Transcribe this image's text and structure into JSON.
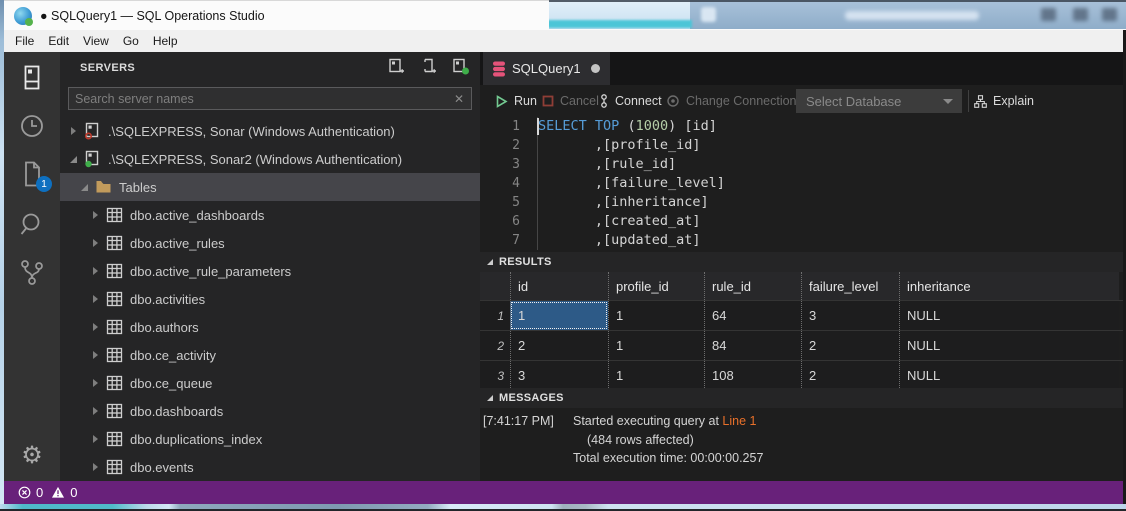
{
  "window": {
    "title": "● SQLQuery1 — SQL Operations Studio",
    "menu": [
      "File",
      "Edit",
      "View",
      "Go",
      "Help"
    ]
  },
  "background_window": {
    "icons": [
      "app-icon",
      "minimize-icon",
      "maximize-icon",
      "close-icon"
    ]
  },
  "activity_bar": {
    "items": [
      {
        "icon": "servers-icon",
        "active": true
      },
      {
        "icon": "task-history-icon",
        "active": false
      },
      {
        "icon": "query-editor-icon",
        "active": false,
        "badge": "1"
      },
      {
        "icon": "search-icon",
        "active": false
      },
      {
        "icon": "source-control-icon",
        "active": false
      }
    ],
    "bottom_icon": "gear-icon",
    "badge_color": "#0e70c0"
  },
  "sidebar": {
    "title": "SERVERS",
    "toolbar_icons": [
      "new-connection-icon",
      "new-server-group-icon",
      "active-connections-icon"
    ],
    "search": {
      "placeholder": "Search server names",
      "value": "",
      "clear_icon": "close-icon"
    },
    "tree": [
      {
        "level": 0,
        "state": "collapsed",
        "icon": "server",
        "status": "disconnected",
        "label": ".\\SQLEXPRESS, Sonar (Windows Authentication)",
        "selected": false
      },
      {
        "level": 0,
        "state": "expanded",
        "icon": "server",
        "status": "connected",
        "label": ".\\SQLEXPRESS, Sonar2 (Windows Authentication)",
        "selected": false
      },
      {
        "level": 1,
        "state": "expanded",
        "icon": "folder",
        "label": "Tables",
        "selected": true
      },
      {
        "level": 2,
        "state": "collapsed",
        "icon": "table",
        "label": "dbo.active_dashboards",
        "selected": false
      },
      {
        "level": 2,
        "state": "collapsed",
        "icon": "table",
        "label": "dbo.active_rules",
        "selected": false
      },
      {
        "level": 2,
        "state": "collapsed",
        "icon": "table",
        "label": "dbo.active_rule_parameters",
        "selected": false
      },
      {
        "level": 2,
        "state": "collapsed",
        "icon": "table",
        "label": "dbo.activities",
        "selected": false
      },
      {
        "level": 2,
        "state": "collapsed",
        "icon": "table",
        "label": "dbo.authors",
        "selected": false
      },
      {
        "level": 2,
        "state": "collapsed",
        "icon": "table",
        "label": "dbo.ce_activity",
        "selected": false
      },
      {
        "level": 2,
        "state": "collapsed",
        "icon": "table",
        "label": "dbo.ce_queue",
        "selected": false
      },
      {
        "level": 2,
        "state": "collapsed",
        "icon": "table",
        "label": "dbo.dashboards",
        "selected": false
      },
      {
        "level": 2,
        "state": "collapsed",
        "icon": "table",
        "label": "dbo.duplications_index",
        "selected": false
      },
      {
        "level": 2,
        "state": "collapsed",
        "icon": "table",
        "label": "dbo.events",
        "selected": false
      }
    ]
  },
  "editor": {
    "tab": {
      "label": "SQLQuery1",
      "dirty": true,
      "icon": "database-icon"
    },
    "toolbar": {
      "run": "Run",
      "cancel": "Cancel",
      "connect": "Connect",
      "change_connection": "Change Connection",
      "database_dropdown": "Select Database",
      "explain": "Explain"
    },
    "code_lines": [
      {
        "num": "1",
        "segments": [
          {
            "t": "SELECT",
            "c": "kw"
          },
          {
            "t": " ",
            "c": ""
          },
          {
            "t": "TOP",
            "c": "kw"
          },
          {
            "t": " (",
            "c": ""
          },
          {
            "t": "1000",
            "c": "num"
          },
          {
            "t": ") [id]",
            "c": ""
          }
        ]
      },
      {
        "num": "2",
        "segments": [
          {
            "t": "       ,[profile_id]",
            "c": ""
          }
        ]
      },
      {
        "num": "3",
        "segments": [
          {
            "t": "       ,[rule_id]",
            "c": ""
          }
        ]
      },
      {
        "num": "4",
        "segments": [
          {
            "t": "       ,[failure_level]",
            "c": ""
          }
        ]
      },
      {
        "num": "5",
        "segments": [
          {
            "t": "       ,[inheritance]",
            "c": ""
          }
        ]
      },
      {
        "num": "6",
        "segments": [
          {
            "t": "       ,[created_at]",
            "c": ""
          }
        ]
      },
      {
        "num": "7",
        "segments": [
          {
            "t": "       ,[updated_at]",
            "c": ""
          }
        ]
      }
    ]
  },
  "results": {
    "title": "RESULTS",
    "columns": [
      "id",
      "profile_id",
      "rule_id",
      "failure_level",
      "inheritance"
    ],
    "rows": [
      {
        "n": "1",
        "cells": [
          "1",
          "1",
          "64",
          "3",
          "NULL"
        ]
      },
      {
        "n": "2",
        "cells": [
          "2",
          "1",
          "84",
          "2",
          "NULL"
        ]
      },
      {
        "n": "3",
        "cells": [
          "3",
          "1",
          "108",
          "2",
          "NULL"
        ]
      }
    ],
    "selected_cell": {
      "row": 0,
      "col": 0
    },
    "selected_color": "#2d5a87"
  },
  "messages": {
    "title": "MESSAGES",
    "timestamp": "[7:41:17 PM]",
    "lines": [
      {
        "text": "Started executing query at ",
        "link": "Line 1"
      },
      {
        "text": "(484 rows affected)",
        "link": null
      },
      {
        "text": "Total execution time: 00:00:00.257",
        "link": null
      }
    ],
    "link_color": "#e8702a"
  },
  "status_bar": {
    "errors": "0",
    "warnings": "0",
    "background": "#68217a"
  },
  "colors": {
    "keyword": "#569cd6",
    "number_literal": "#b5cea8",
    "folder": "#c29b5c",
    "connected": "#3fae4a",
    "disconnected": "#c0392b",
    "tab_db_icon": "#e5537a",
    "run_green": "#73c991"
  }
}
